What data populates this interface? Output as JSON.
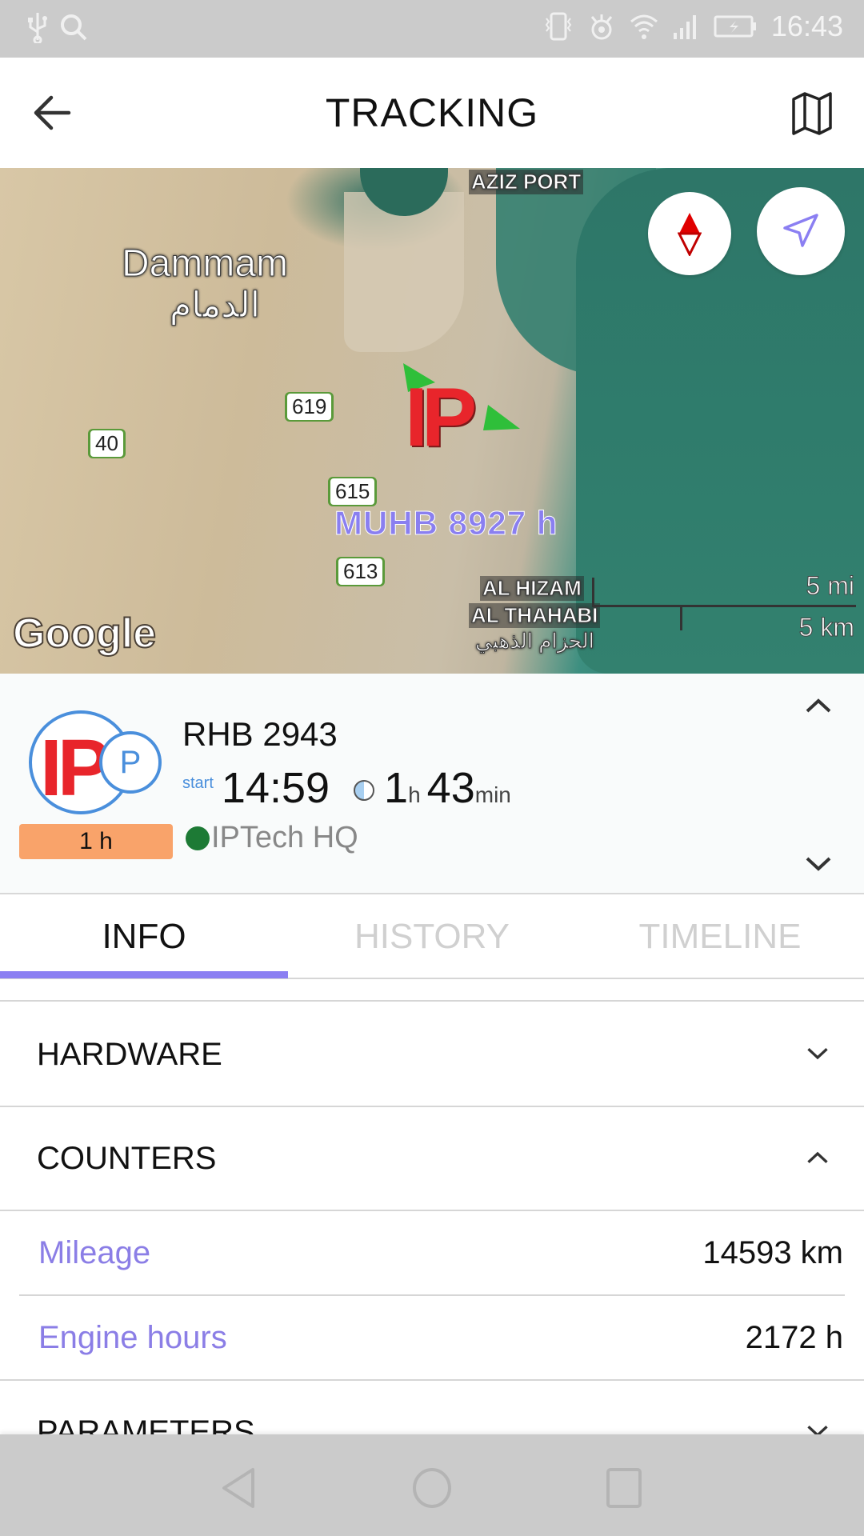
{
  "status_bar": {
    "time": "16:43",
    "left_icons": [
      "usb-icon",
      "search-icon"
    ],
    "right_icons": [
      "vibrate-icon",
      "eye-comfort-icon",
      "wifi-icon",
      "signal-icon",
      "battery-charging-icon"
    ]
  },
  "app_bar": {
    "title": "TRACKING",
    "back_icon": "arrow-left-icon",
    "map_icon": "map-icon"
  },
  "map": {
    "labels": {
      "city_en": "Dammam",
      "city_ar": "الدمام",
      "port": "AZIZ PORT",
      "district_en_1": "AL HIZAM",
      "district_en_2": "AL THAHABI",
      "district_ar": "الحزام الذهبي"
    },
    "road_shields": [
      "619",
      "40",
      "615",
      "613"
    ],
    "vehicle_label": "MUHB 8927 h",
    "attribution": "Google",
    "scale": {
      "imperial": "5 mi",
      "metric": "5 km"
    },
    "controls": {
      "compass_icon": "compass-icon",
      "locate_icon": "navigation-arrow-icon"
    },
    "accent_color": "#8b7ff2"
  },
  "vehicle": {
    "plate": "RHB 2943",
    "start_label": "start",
    "start_time": "14:59",
    "duration_hours": "1",
    "duration_hours_unit": "h",
    "duration_minutes": "43",
    "duration_minutes_unit": "min",
    "avatar_text": "IP",
    "avatar_sub_text": "P",
    "badge": "1 h",
    "location": "IPTech HQ",
    "status_color": "#1d7a35"
  },
  "tabs": [
    {
      "label": "INFO",
      "active": true
    },
    {
      "label": "HISTORY",
      "active": false
    },
    {
      "label": "TIMELINE",
      "active": false
    }
  ],
  "sections": {
    "hardware": {
      "label": "HARDWARE",
      "expanded": false
    },
    "counters": {
      "label": "COUNTERS",
      "expanded": true,
      "rows": [
        {
          "key": "Mileage",
          "value": "14593 km"
        },
        {
          "key": "Engine hours",
          "value": "2172 h"
        }
      ]
    },
    "parameters": {
      "label": "PARAMETERS",
      "expanded": false
    }
  },
  "nav_bar": {
    "buttons": [
      "back-triangle-icon",
      "home-circle-icon",
      "recents-square-icon"
    ]
  }
}
